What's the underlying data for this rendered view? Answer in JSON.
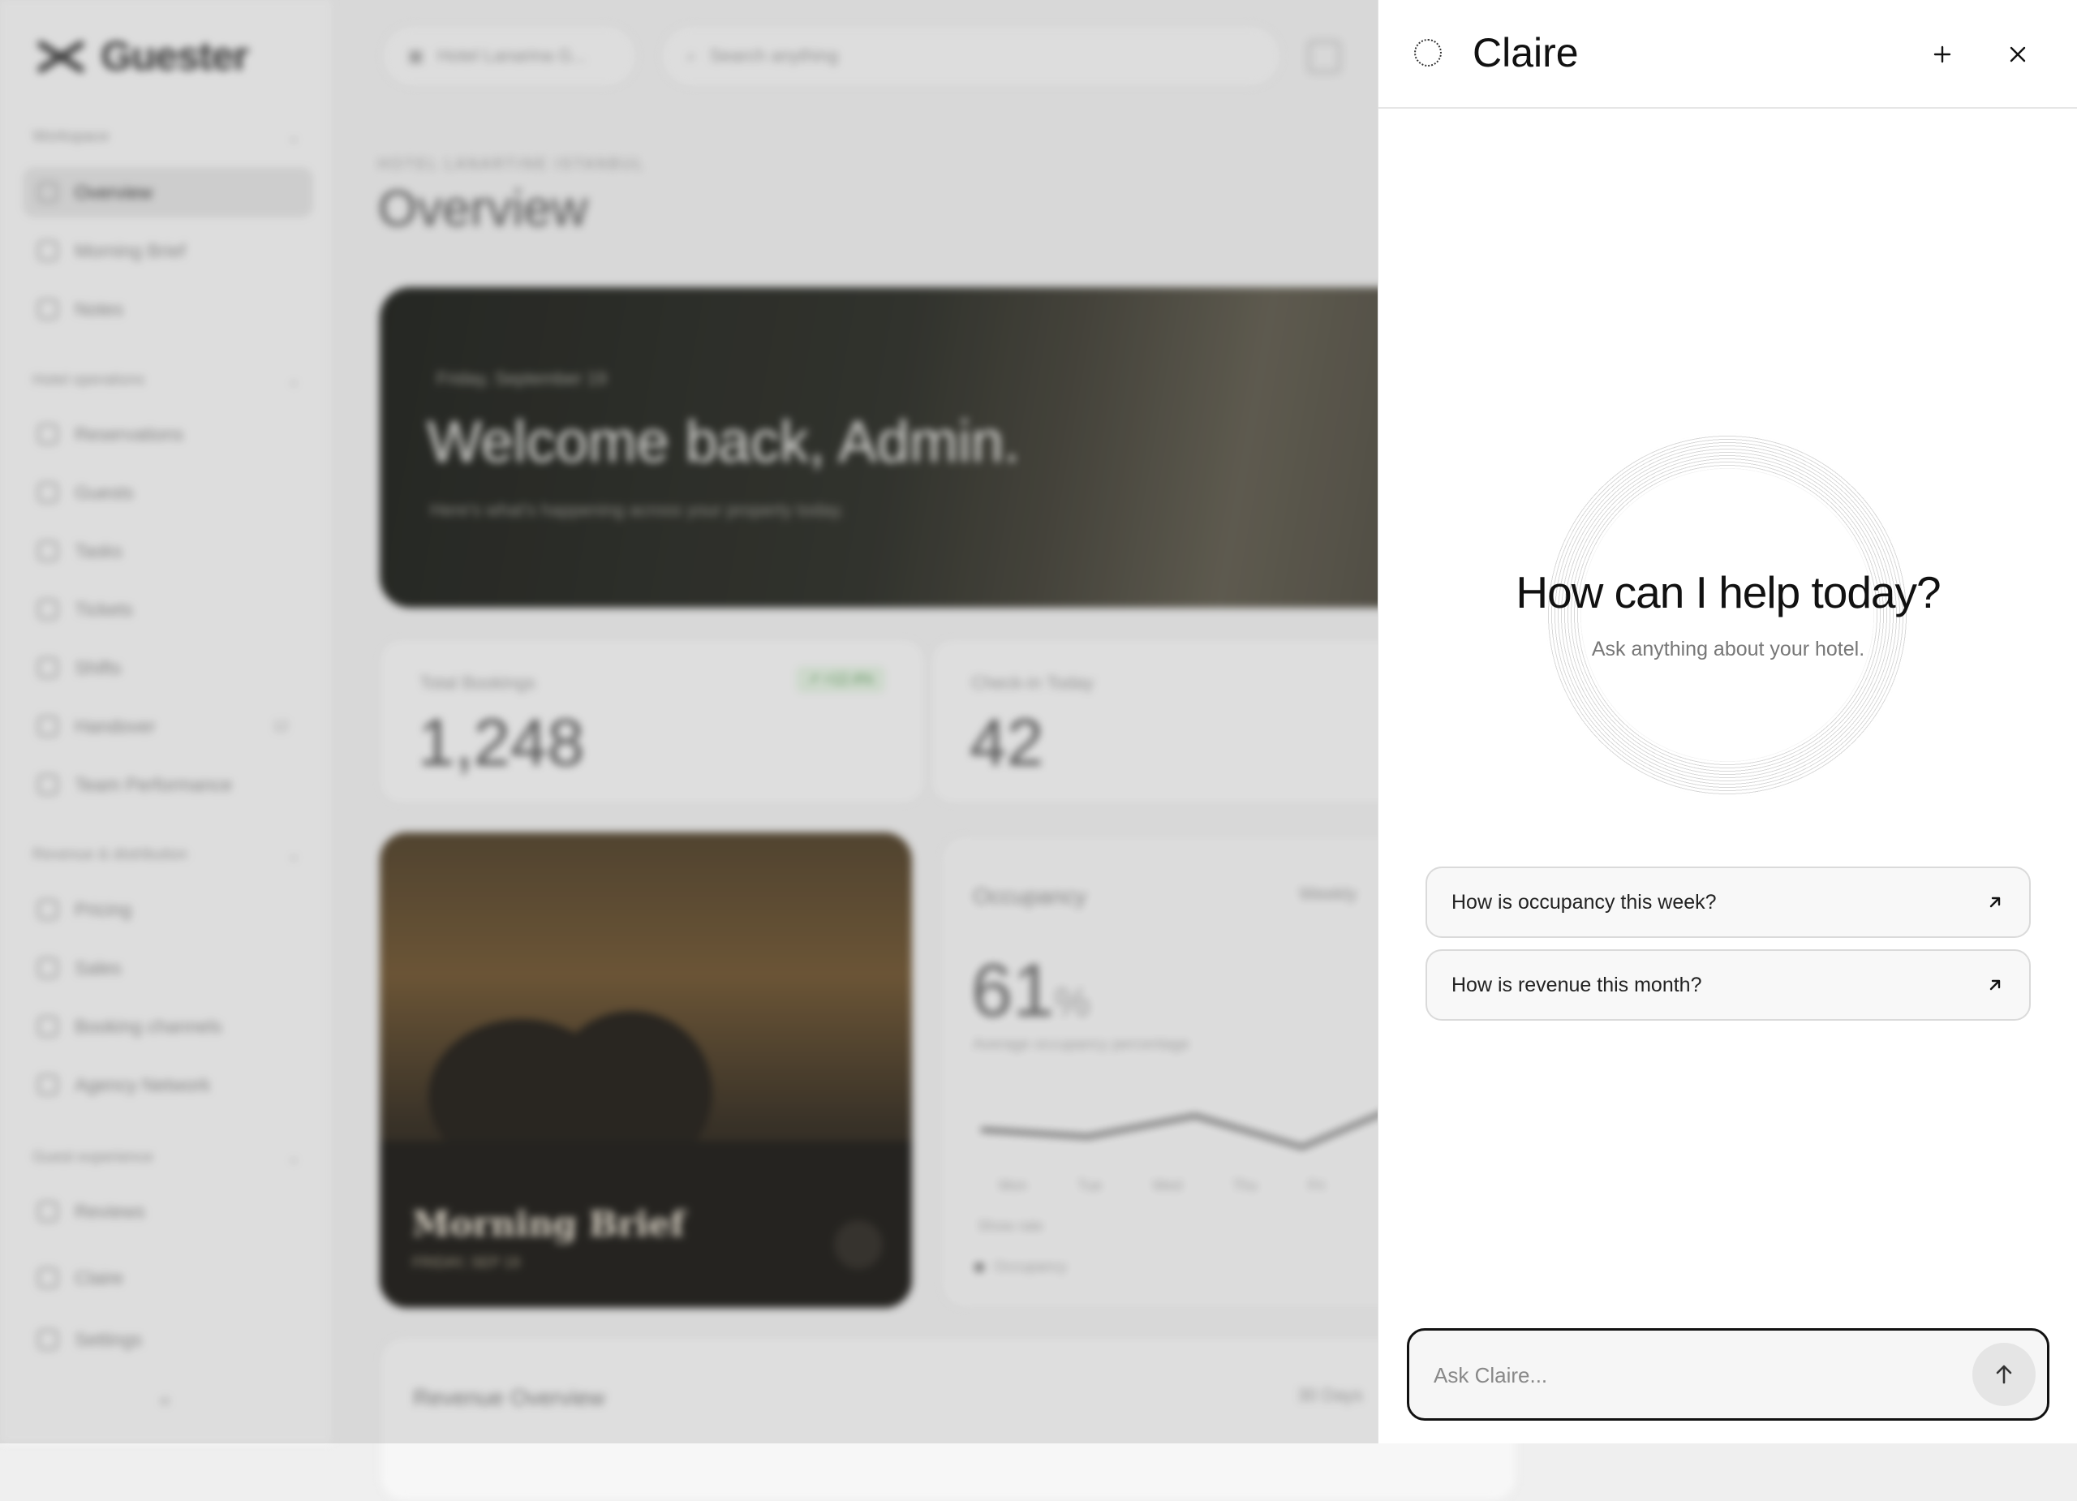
{
  "app": {
    "logo_text": "Guester",
    "property_selector": "Hotel Lanarina G...",
    "search_placeholder": "Search anything",
    "sidebar": {
      "sections": [
        {
          "label": "Workspace"
        },
        {
          "label": "Hotel operations"
        },
        {
          "label": "Revenue & distribution"
        },
        {
          "label": "Guest experience"
        }
      ],
      "items": [
        {
          "label": "Overview"
        },
        {
          "label": "Morning Brief"
        },
        {
          "label": "Notes"
        },
        {
          "label": "Reservations"
        },
        {
          "label": "Guests"
        },
        {
          "label": "Tasks"
        },
        {
          "label": "Tickets"
        },
        {
          "label": "Shifts"
        },
        {
          "label": "Handover",
          "count": "12"
        },
        {
          "label": "Team Performance"
        },
        {
          "label": "Pricing"
        },
        {
          "label": "Sales"
        },
        {
          "label": "Booking channels"
        },
        {
          "label": "Agency Network"
        },
        {
          "label": "Reviews"
        },
        {
          "label": "Claire"
        },
        {
          "label": "Settings"
        }
      ],
      "collapse_glyph": "«"
    },
    "page": {
      "kicker": "HOTEL LANARTINE ISTANBUL",
      "title": "Overview"
    },
    "hero": {
      "date": "Friday, September 19",
      "welcome": "Welcome back, Admin.",
      "subtitle": "Here's what's happening across your property today."
    },
    "stats": [
      {
        "label": "Total Bookings",
        "value": "1,248",
        "badge": "↗ +12.4%"
      },
      {
        "label": "Check-in Today",
        "value": "42"
      }
    ],
    "morning_brief": {
      "title": "Morning Brief",
      "date": "FRIDAY, SEP 19"
    },
    "occupancy": {
      "title": "Occupancy",
      "period": "Weekly",
      "value": "61",
      "unit": "%",
      "description": "Average occupancy percentage",
      "days": [
        "Mon",
        "Tue",
        "Wed",
        "Thu",
        "Fri"
      ],
      "show_rate": "Show rate",
      "legend": "Occupancy",
      "values": [
        58,
        56,
        62,
        53,
        66,
        64
      ]
    },
    "revenue": {
      "title": "Revenue Overview",
      "period": "30 Days"
    }
  },
  "assistant": {
    "name": "Claire",
    "heading": "How can I help today?",
    "subheading": "Ask anything about your hotel.",
    "suggestions": [
      {
        "text": "How is occupancy this week?"
      },
      {
        "text": "How is revenue this month?"
      }
    ],
    "input_placeholder": "Ask Claire...",
    "icons": {
      "assistant": "claire-sparkle-icon",
      "new_chat": "plus-icon",
      "close": "close-icon",
      "suggestion": "arrow-up-right-icon",
      "send": "arrow-up-icon"
    }
  }
}
